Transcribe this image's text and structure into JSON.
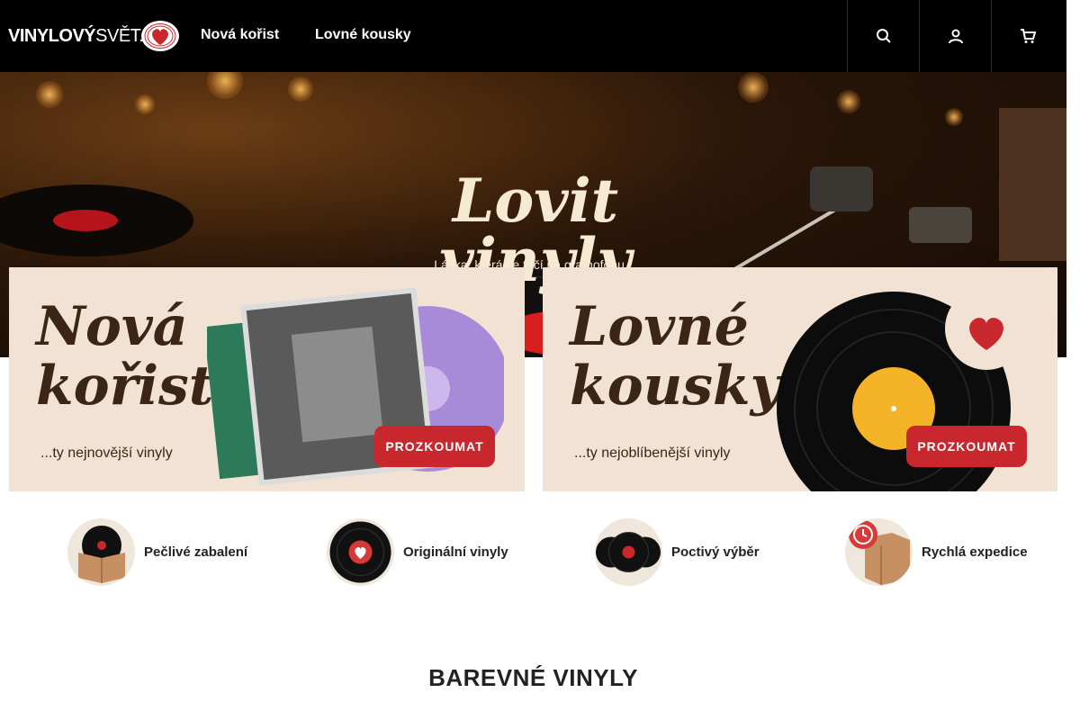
{
  "header": {
    "logo_bold": "VINYLOVÝ",
    "logo_light": "SVĚT.CZ",
    "nav": [
      {
        "label": "Nová kořist"
      },
      {
        "label": "Lovné kousky"
      }
    ],
    "icons": [
      "search-icon",
      "user-icon",
      "cart-icon"
    ]
  },
  "hero": {
    "title": "Lovit vinyly",
    "subtitle": "Láska, která se točí na gramofonu."
  },
  "promos": [
    {
      "title_line1": "Nová",
      "title_line2": "kořist",
      "subtitle": "...ty nejnovější vinyly",
      "button": "PROZKOUMAT"
    },
    {
      "title_line1": "Lovné",
      "title_line2": "kousky",
      "subtitle": "...ty nejoblíbenější vinyly",
      "button": "PROZKOUMAT"
    }
  ],
  "features": [
    {
      "label": "Pečlivé zabalení",
      "icon": "box-record-icon"
    },
    {
      "label": "Originální vinyly",
      "icon": "record-heart-icon"
    },
    {
      "label": "Poctivý výběr",
      "icon": "records-stack-icon"
    },
    {
      "label": "Rychlá expedice",
      "icon": "box-clock-icon"
    }
  ],
  "section": {
    "title": "BAREVNÉ VINYLY"
  },
  "colors": {
    "accent": "#c8272e",
    "header_bg": "#000000",
    "promo_bg": "#f1e2d3"
  }
}
